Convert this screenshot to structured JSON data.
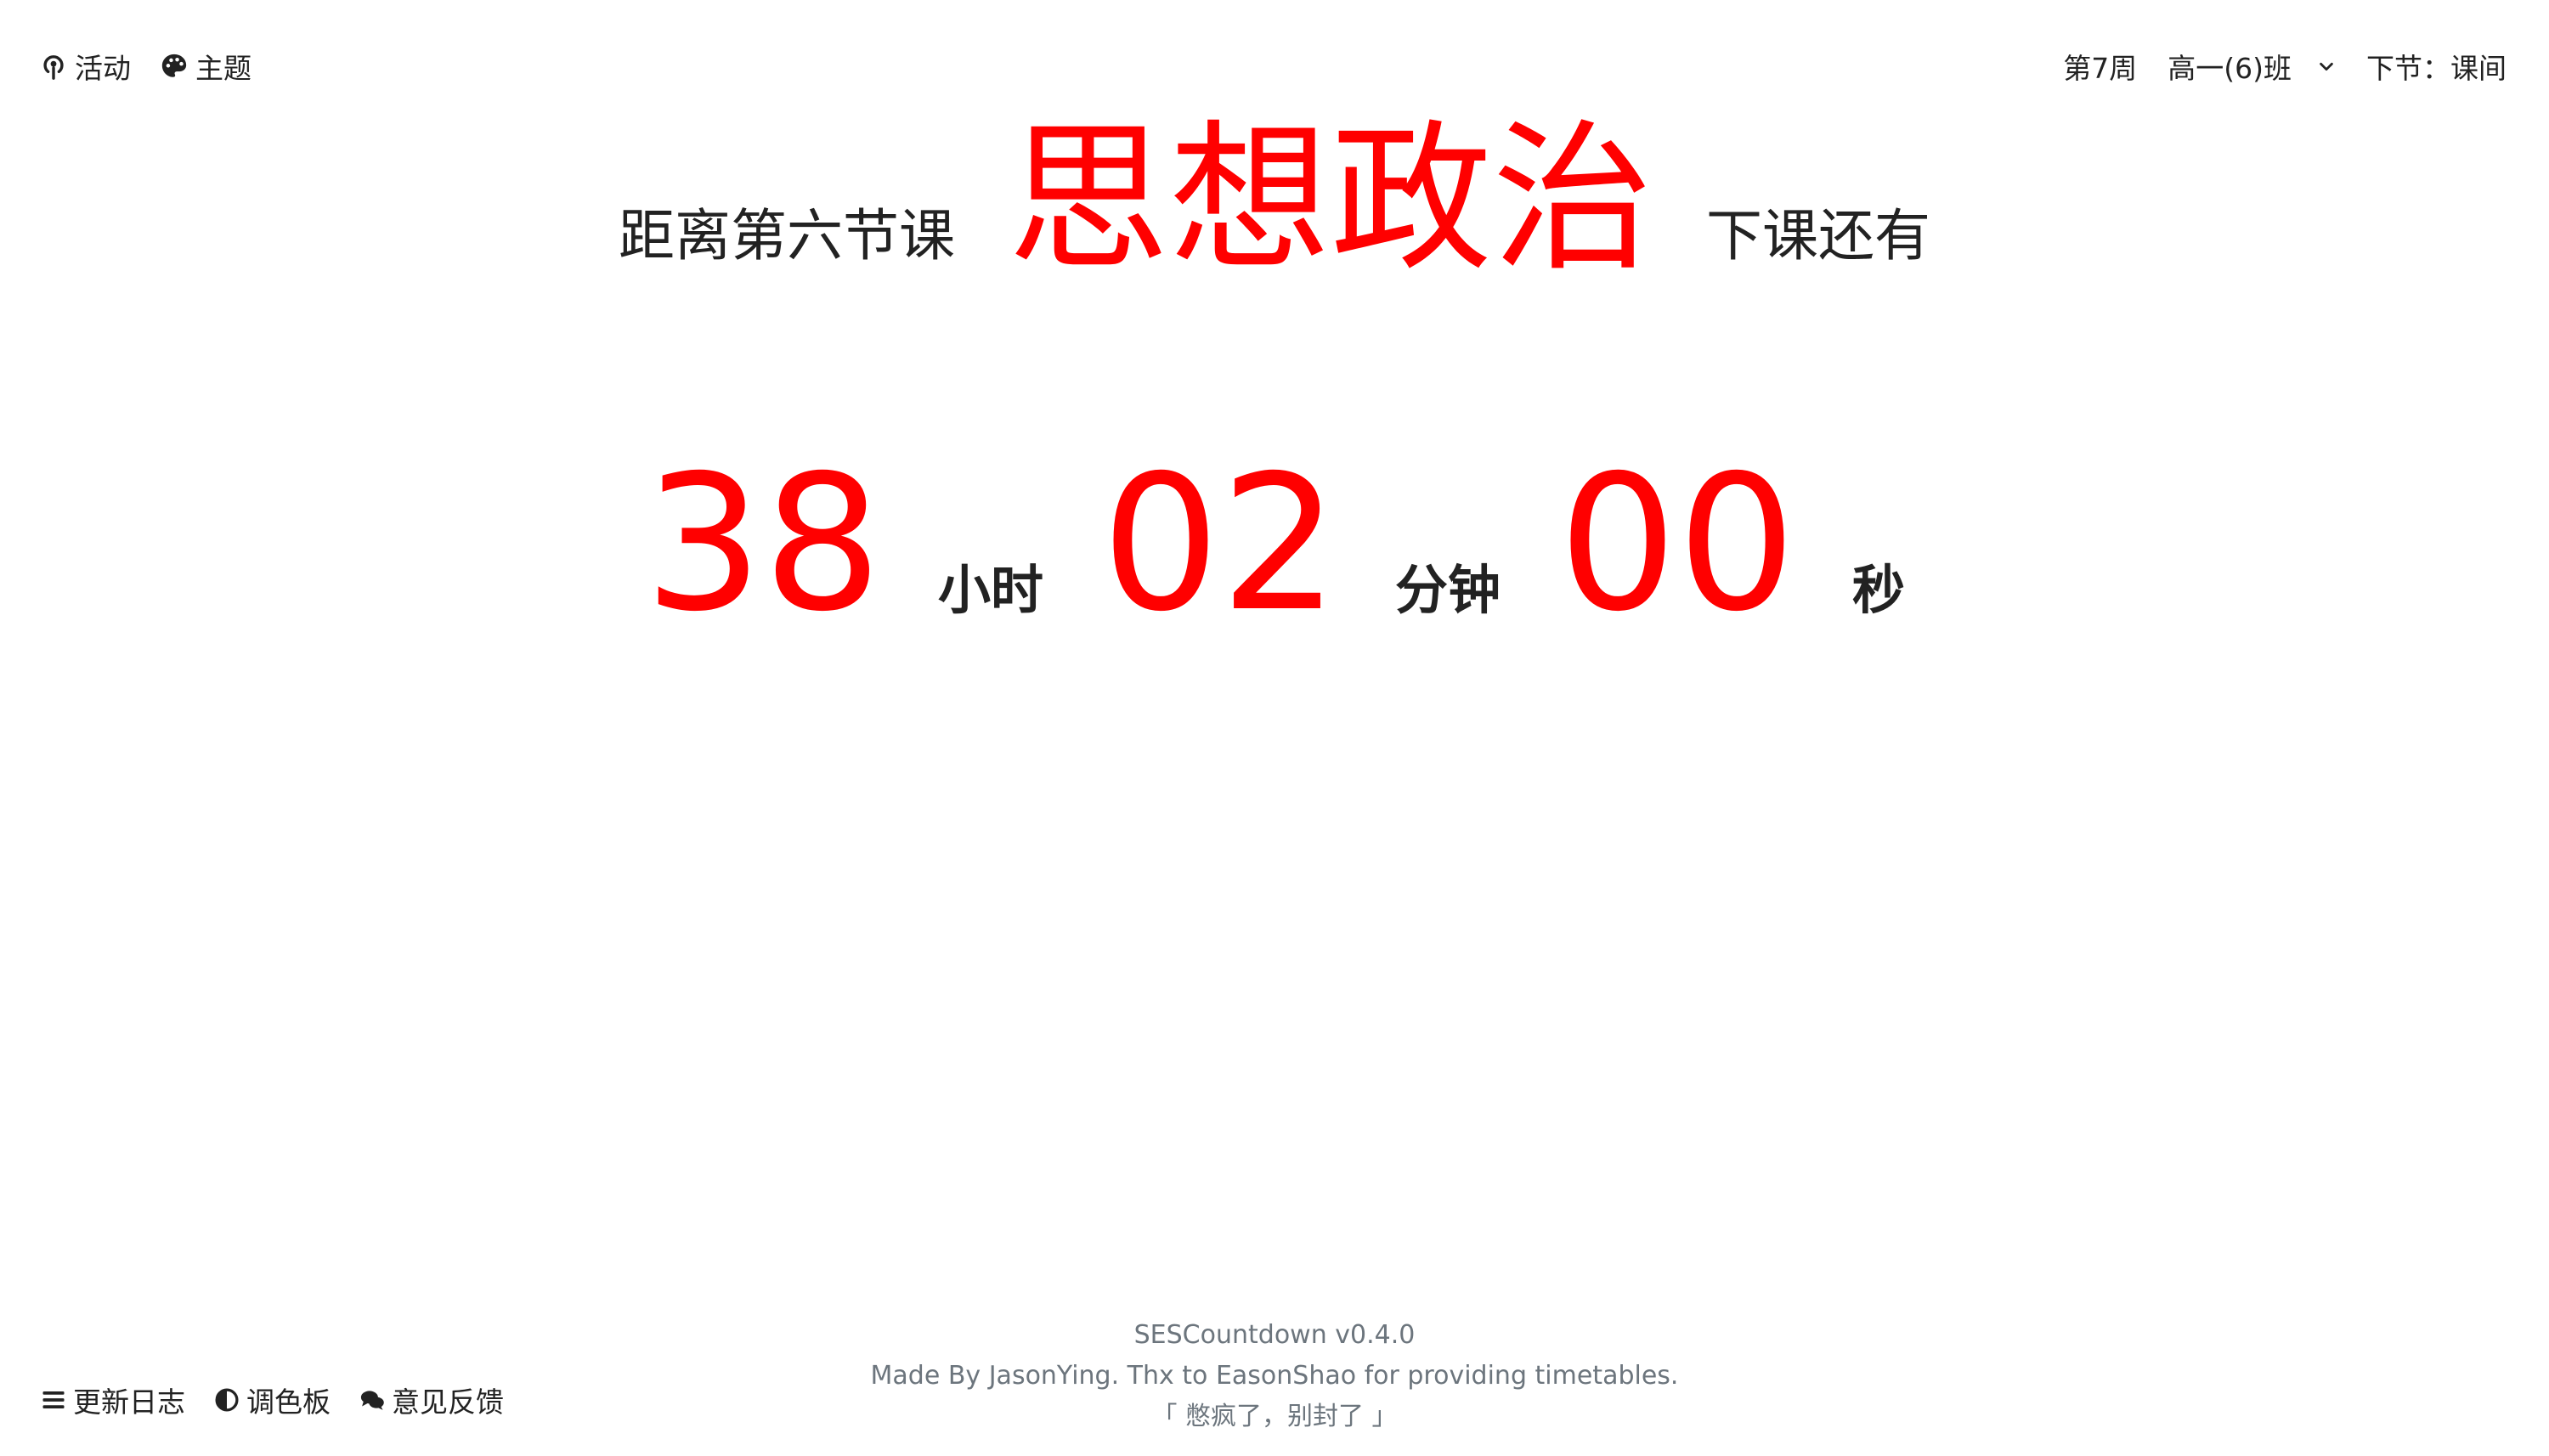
{
  "topnav": {
    "activity_label": "活动",
    "theme_label": "主题",
    "week": "第7周",
    "class_selected": "高一(6)班",
    "next_class": "下节：课间"
  },
  "headline": {
    "prefix": "距离第六节课",
    "subject": "思想政治",
    "suffix": "下课还有"
  },
  "countdown": {
    "hours": "38",
    "hours_unit": "小时",
    "minutes": "02",
    "minutes_unit": "分钟",
    "seconds": "00",
    "seconds_unit": "秒"
  },
  "bottom_links": {
    "changelog": "更新日志",
    "palette": "调色板",
    "feedback": "意见反馈"
  },
  "footer": {
    "version": "SESCountdown v0.4.0",
    "credits": "Made By JasonYing. Thx to EasonShao for providing timetables.",
    "motto": "「 憋疯了，别封了 」"
  },
  "colors": {
    "accent": "#ff0000",
    "text": "#222222",
    "muted": "#6c757d",
    "background": "#ffffff"
  },
  "icons": [
    "podcast-icon",
    "palette-icon",
    "chevron-down-icon",
    "list-icon",
    "contrast-icon",
    "comments-icon"
  ]
}
